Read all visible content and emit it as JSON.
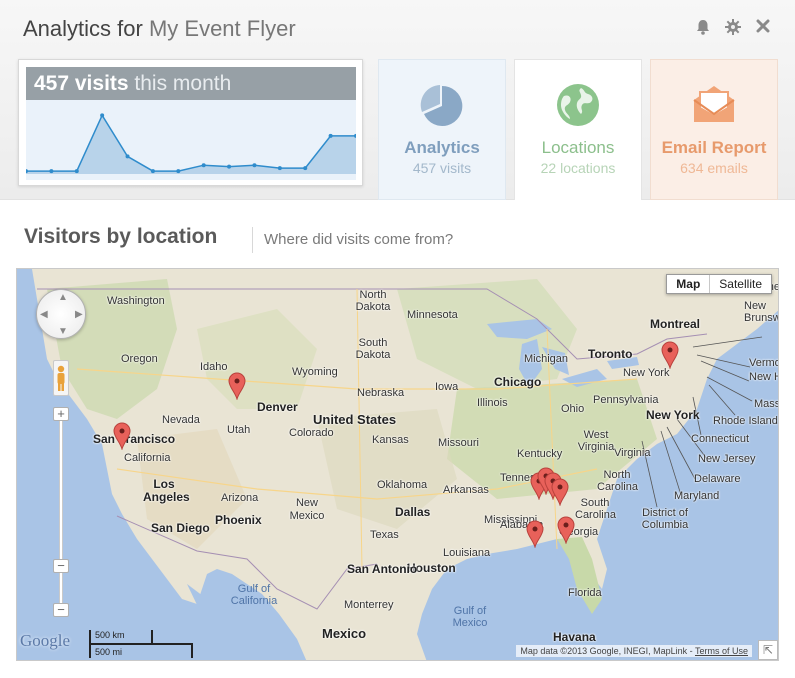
{
  "header": {
    "title_prefix": "Analytics for",
    "title_name": "My Event Flyer",
    "icons": [
      "bell-icon",
      "gear-icon",
      "close-icon"
    ]
  },
  "visits_card": {
    "count_label": "457 visits",
    "period_label": "this month",
    "sparkline": [
      2,
      2,
      2,
      40,
      12,
      2,
      2,
      6,
      5,
      6,
      4,
      4,
      26,
      26
    ]
  },
  "tiles": [
    {
      "name": "Analytics",
      "sub": "457 visits",
      "icon": "pie-chart-icon"
    },
    {
      "name": "Locations",
      "sub": "22 locations",
      "icon": "globe-icon"
    },
    {
      "name": "Email Report",
      "sub": "634 emails",
      "icon": "envelope-icon"
    }
  ],
  "section": {
    "title": "Visitors by location",
    "subtitle": "Where did visits come from?"
  },
  "map": {
    "type_buttons": [
      "Map",
      "Satellite"
    ],
    "country_label": "United States",
    "mexico_label": "Mexico",
    "state_labels": [
      "Washington",
      "Oregon",
      "Idaho",
      "Wyoming",
      "Nevada",
      "Utah",
      "Colorado",
      "California",
      "Arizona",
      "New Mexico",
      "North Dakota",
      "South Dakota",
      "Nebraska",
      "Kansas",
      "Oklahoma",
      "Texas",
      "Minnesota",
      "Iowa",
      "Missouri",
      "Arkansas",
      "Louisiana",
      "Illinois",
      "Michigan",
      "Ohio",
      "Kentucky",
      "Tennessee",
      "Mississippi",
      "Alabama",
      "Georgia",
      "Florida",
      "North Carolina",
      "South Carolina",
      "Virginia",
      "West Virginia",
      "Pennsylvania",
      "New York",
      "Maine"
    ],
    "city_labels": [
      "San Francisco",
      "Los Angeles",
      "San Diego",
      "Phoenix",
      "Denver",
      "Dallas",
      "Houston",
      "San Antonio",
      "Chicago",
      "Toronto",
      "Montreal",
      "New York",
      "Havana",
      "Monterrey"
    ],
    "water_labels": [
      "Gulf of California",
      "Gulf of Mexico"
    ],
    "ne_labels": [
      "New Brunswick",
      "Vermont",
      "New Hampshire",
      "Massachusetts",
      "Rhode Island",
      "Connecticut",
      "New Jersey",
      "Delaware",
      "Maryland",
      "District of Columbia"
    ],
    "logo": "Google",
    "scale_km": "500 km",
    "scale_mi": "500 mi",
    "attribution": "Map data ©2013 Google, INEGI, MapLink -",
    "terms": "Terms of Use",
    "pins": 22
  },
  "colors": {
    "analytics": "#7f9ebd",
    "locations": "#8cbf8c",
    "email": "#e79a6c",
    "pin": "#e8615a"
  }
}
